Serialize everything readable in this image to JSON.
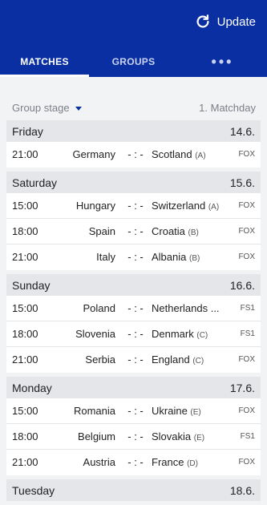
{
  "header": {
    "update_label": "Update"
  },
  "tabs": [
    {
      "label": "MATCHES"
    },
    {
      "label": "GROUPS"
    },
    {
      "label": "•••"
    }
  ],
  "filter": {
    "stage": "Group stage",
    "matchday": "1. Matchday"
  },
  "days": [
    {
      "name": "Friday",
      "date": "14.6.",
      "matches": [
        {
          "time": "21:00",
          "home": "Germany",
          "score": "- : -",
          "away": "Scotland",
          "group": "(A)",
          "tv": "FOX"
        }
      ]
    },
    {
      "name": "Saturday",
      "date": "15.6.",
      "matches": [
        {
          "time": "15:00",
          "home": "Hungary",
          "score": "- : -",
          "away": "Switzerland",
          "group": "(A)",
          "tv": "FOX"
        },
        {
          "time": "18:00",
          "home": "Spain",
          "score": "- : -",
          "away": "Croatia",
          "group": "(B)",
          "tv": "FOX"
        },
        {
          "time": "21:00",
          "home": "Italy",
          "score": "- : -",
          "away": "Albania",
          "group": "(B)",
          "tv": "FOX"
        }
      ]
    },
    {
      "name": "Sunday",
      "date": "16.6.",
      "matches": [
        {
          "time": "15:00",
          "home": "Poland",
          "score": "- : -",
          "away": "Netherlands ...",
          "group": "",
          "tv": "FS1"
        },
        {
          "time": "18:00",
          "home": "Slovenia",
          "score": "- : -",
          "away": "Denmark",
          "group": "(C)",
          "tv": "FS1"
        },
        {
          "time": "21:00",
          "home": "Serbia",
          "score": "- : -",
          "away": "England",
          "group": "(C)",
          "tv": "FOX"
        }
      ]
    },
    {
      "name": "Monday",
      "date": "17.6.",
      "matches": [
        {
          "time": "15:00",
          "home": "Romania",
          "score": "- : -",
          "away": "Ukraine",
          "group": "(E)",
          "tv": "FOX"
        },
        {
          "time": "18:00",
          "home": "Belgium",
          "score": "- : -",
          "away": "Slovakia",
          "group": "(E)",
          "tv": "FS1"
        },
        {
          "time": "21:00",
          "home": "Austria",
          "score": "- : -",
          "away": "France",
          "group": "(D)",
          "tv": "FOX"
        }
      ]
    },
    {
      "name": "Tuesday",
      "date": "18.6.",
      "matches": []
    }
  ],
  "colors": {
    "brand": "#0a2fa3",
    "day_header_bg": "#e4e6ea"
  }
}
